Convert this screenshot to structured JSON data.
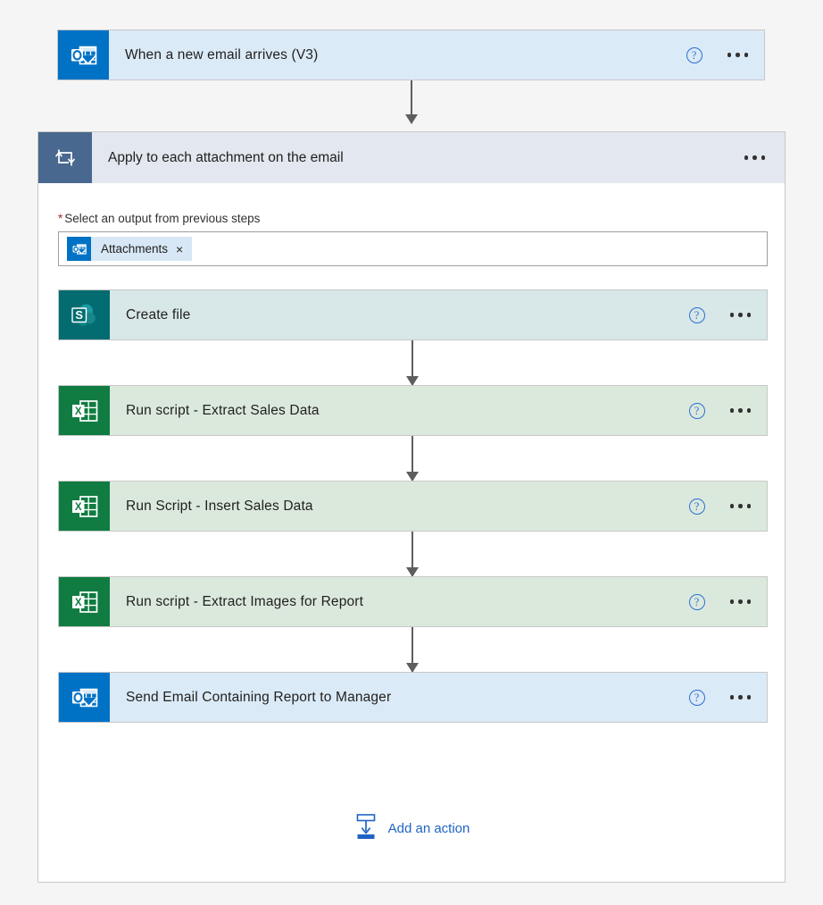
{
  "trigger": {
    "title": "When a new email arrives (V3)",
    "icon": "outlook-icon",
    "theme": "outlook",
    "help_label": "?",
    "menu_label": "More commands"
  },
  "scope": {
    "title": "Apply to each attachment on the email",
    "icon": "loop-icon",
    "menu_label": "More commands",
    "field": {
      "required_marker": "*",
      "label": "Select an output from previous steps",
      "token": {
        "label": "Attachments",
        "icon": "outlook-icon",
        "remove_label": "×"
      }
    },
    "actions": [
      {
        "title": "Create file",
        "icon": "sharepoint-icon",
        "theme": "sharepoint",
        "help_label": "?",
        "menu_label": "More commands"
      },
      {
        "title": "Run script - Extract Sales Data",
        "icon": "excel-icon",
        "theme": "excel",
        "help_label": "?",
        "menu_label": "More commands"
      },
      {
        "title": "Run Script - Insert Sales Data",
        "icon": "excel-icon",
        "theme": "excel",
        "help_label": "?",
        "menu_label": "More commands"
      },
      {
        "title": "Run script - Extract Images for Report",
        "icon": "excel-icon",
        "theme": "excel",
        "help_label": "?",
        "menu_label": "More commands"
      },
      {
        "title": "Send Email Containing Report to Manager",
        "icon": "outlook-icon",
        "theme": "outlook",
        "help_label": "?",
        "menu_label": "More commands"
      }
    ],
    "add_action": {
      "label": "Add an action",
      "icon": "insert-action-icon"
    }
  },
  "colors": {
    "page_background": "#f5f5f5",
    "outlook_blue": "#0072c6",
    "outlook_card": "#dbeaf7",
    "sharepoint_teal": "#036c70",
    "sharepoint_card": "#d8e7e7",
    "excel_green": "#107c41",
    "excel_card": "#dbe9dd",
    "loop_header": "#49688f",
    "loop_header_band": "#e3e7ef",
    "link_blue": "#1f64c4",
    "required_red": "#a4262c",
    "connector_gray": "#605e5c"
  }
}
